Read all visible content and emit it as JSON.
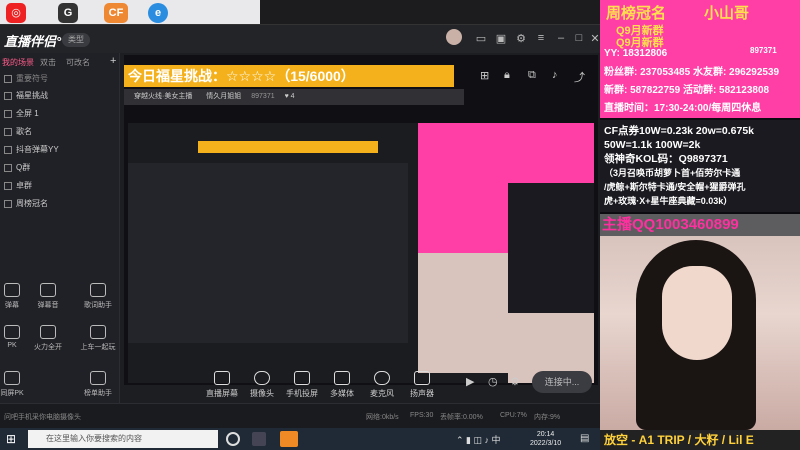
{
  "app": {
    "logo": "直播伴侣°",
    "type_label": "类型"
  },
  "sidebar": {
    "tabs": [
      "我的场景",
      "双击",
      "可改名"
    ],
    "scene_items": [
      "重要符号",
      "福星挑战",
      "全屏 1",
      "歌名",
      "抖音弹幕YY",
      "Q群",
      "卓群",
      "周榜冠名"
    ],
    "tools": [
      "弹幕",
      "弹幕音",
      "歌词助手",
      "PK",
      "火力全开",
      "上车一起玩",
      "同屏PK",
      "榜单助手"
    ]
  },
  "preview": {
    "banner": "今日福星挑战：☆☆☆☆（15/6000）",
    "sub_header": "穿越火线·美女主播",
    "sub_header_right": "情久月姐姐",
    "room_id": "897371",
    "viewer_count": "4"
  },
  "controls": {
    "items": [
      "直播屏幕",
      "摄像头",
      "手机投屏",
      "多媒体",
      "麦克风",
      "扬声器"
    ],
    "live_button": "连接中..."
  },
  "status": {
    "left": "问吧手机采你电脑摄像头",
    "network": "网络:0kb/s",
    "fps": "FPS:30",
    "frame_loss": "丢帧率:0.00%",
    "cpu": "CPU:7%",
    "mem": "内存:9%"
  },
  "overlay": {
    "sponsor": "周榜冠名",
    "sponsor_name": "小山哥",
    "q_group1": "Q9月新群",
    "q_group2": "Q9月新群",
    "yy_label": "YY: 18312806",
    "id_badge": "897371",
    "fan_group": "粉丝群: 237053485 水友群: 296292539",
    "fan_group2": "新群: 587822759 活动群: 582123808",
    "live_time": "直播时间：17:30-24:00/每周四休息",
    "cf_lines": [
      "CF点券10W=0.23k 20w=0.675k",
      "50W=1.1k 100W=2k",
      "领神奇KOL码：Q9897371",
      "（3月召唤币胡萝卜首+佰劳尔卡通",
      "/虎鲸+斯尔特卡通/安全帽+猩爵弹孔",
      "虎+玫瑰·X+星牛座典藏=0.03k）"
    ],
    "anchor_qq": "主播QQ1003460899",
    "song": "放空 - A1 TRIP / 大籽 / Lil E"
  },
  "taskbar": {
    "search_placeholder": "在这里输入你要搜索的内容",
    "time": "20:14",
    "date": "2022/3/10"
  },
  "colors": {
    "accent_orange": "#f4b11c",
    "overlay_pink": "#ff3ea6",
    "overlay_yellow": "#ffe14d"
  }
}
